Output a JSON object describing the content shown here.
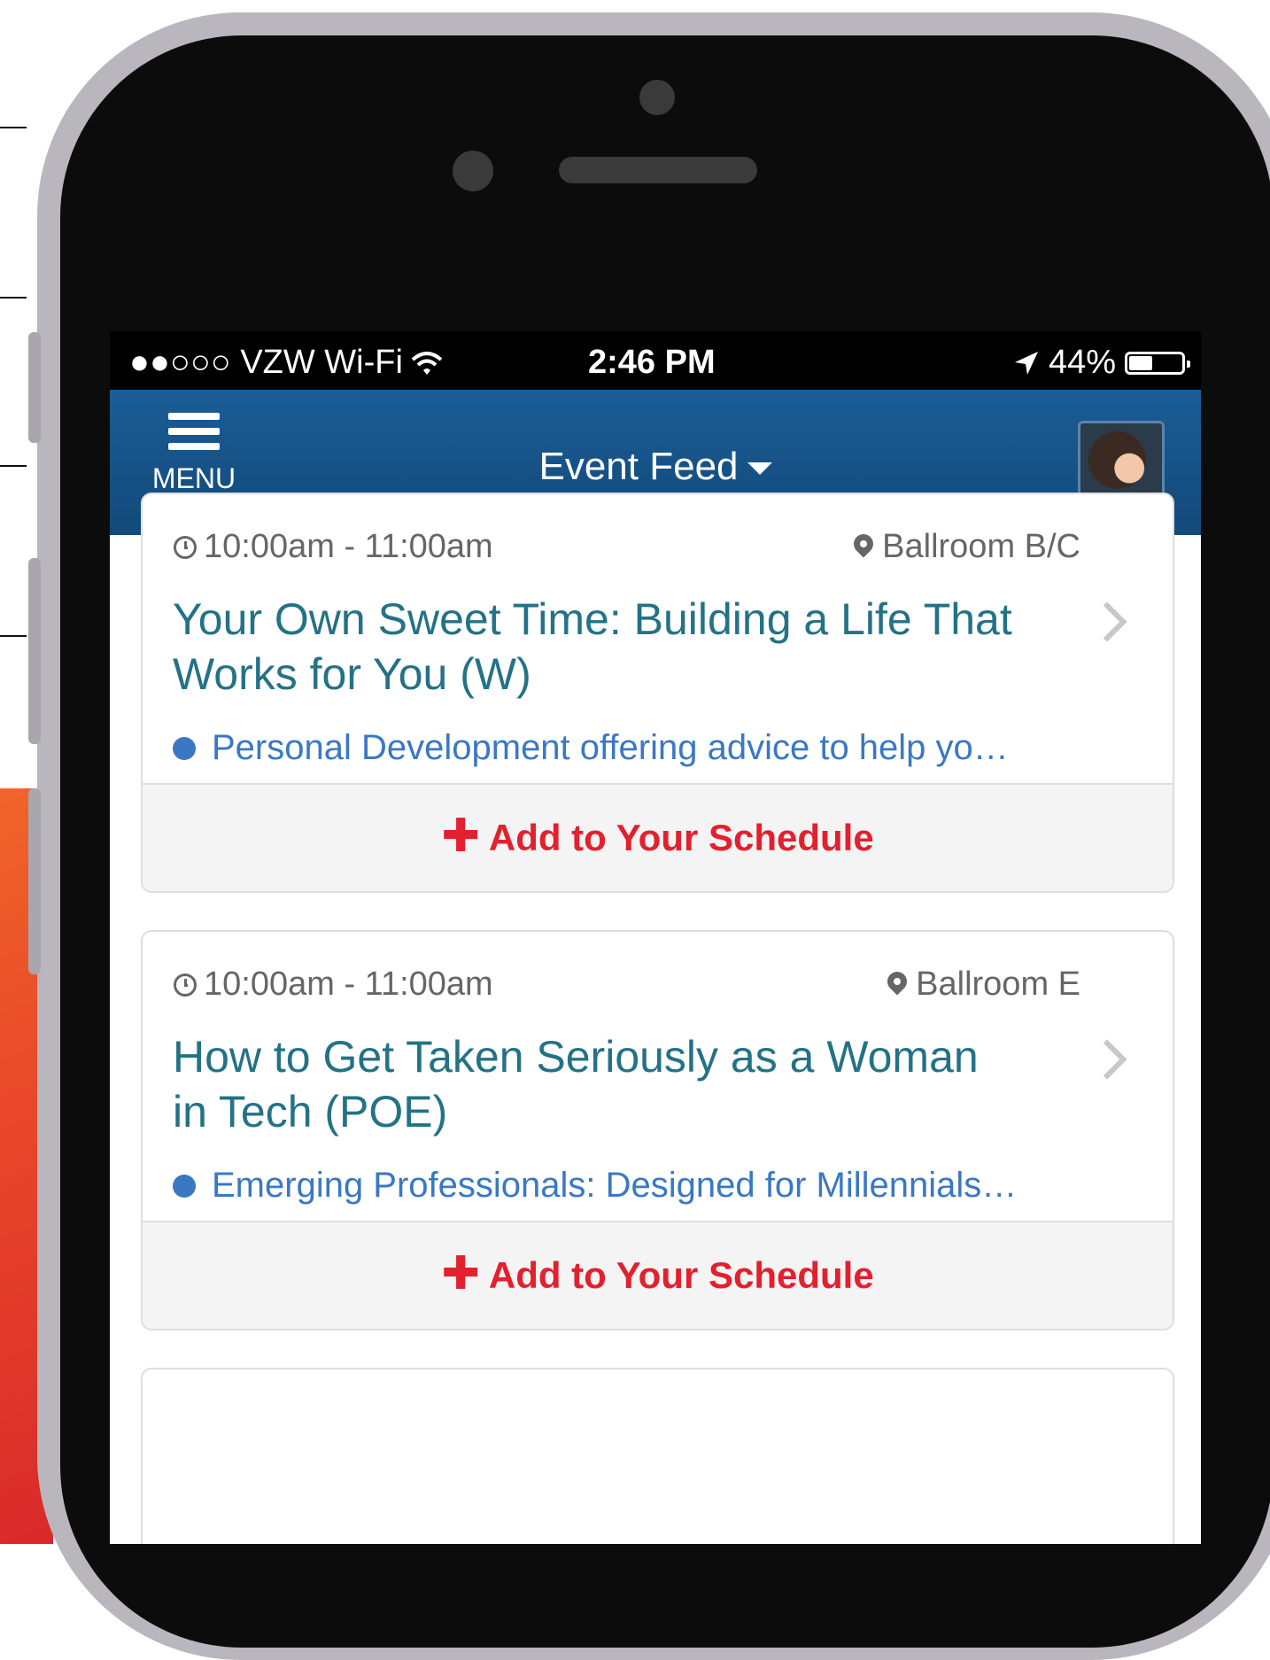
{
  "status_bar": {
    "carrier": "●●○○○ VZW Wi-Fi",
    "time": "2:46 PM",
    "battery": "44%",
    "battery_level": 0.44
  },
  "navbar": {
    "menu_label": "MENU",
    "title": "Event Feed"
  },
  "events": [
    {
      "time": "10:00am - 11:00am",
      "location": "Ballroom B/C",
      "title": "Your Own Sweet Time: Building a Life That Works for You (W)",
      "category": "Personal Development offering advice to help yo…",
      "action": "Add to Your Schedule"
    },
    {
      "time": "10:00am - 11:00am",
      "location": "Ballroom E",
      "title": "How to Get Taken Seriously as a Woman in Tech (POE)",
      "category": "Emerging Professionals: Designed for Millennials…",
      "action": "Add to Your Schedule"
    }
  ],
  "colors": {
    "navbar": "#1b5d96",
    "title": "#237286",
    "category": "#3a78c4",
    "action": "#e3202d"
  }
}
